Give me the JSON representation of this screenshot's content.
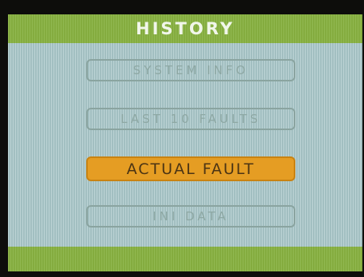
{
  "screen": {
    "title": "HISTORY"
  },
  "menu": {
    "items": [
      {
        "label": "SYSTEM INFO",
        "selected": false
      },
      {
        "label": "LAST 10 FAULTS",
        "selected": false
      },
      {
        "label": "ACTUAL FAULT",
        "selected": true
      },
      {
        "label": "INI DATA",
        "selected": false
      }
    ]
  },
  "colors": {
    "header_bar": "#88b241",
    "background": "#a9c7c9",
    "selected_item": "#e59d23",
    "item_outline": "#8aa4a0"
  }
}
